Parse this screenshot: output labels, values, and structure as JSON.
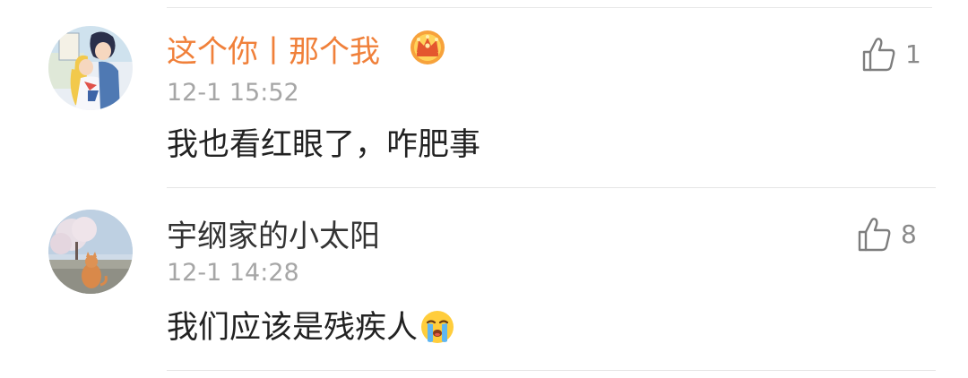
{
  "comments": [
    {
      "username": "这个你丨那个我",
      "badge_icon": "crown-icon",
      "time": "12-1 15:52",
      "content": "我也看红眼了，咋肥事",
      "like_count": "1",
      "like_icon": "thumbs-up-icon",
      "username_color": "#f0803a"
    },
    {
      "username": "宇纲家的小太阳",
      "time": "12-1 14:28",
      "content": "我们应该是残疾人",
      "content_emoji": "crying-face-emoji",
      "like_count": "8",
      "like_icon": "thumbs-up-icon",
      "username_color": "#333333"
    }
  ],
  "colors": {
    "time": "#a6a6a6",
    "content": "#222222",
    "like_count": "#8a8a8a",
    "divider": "#e5e5e5"
  }
}
